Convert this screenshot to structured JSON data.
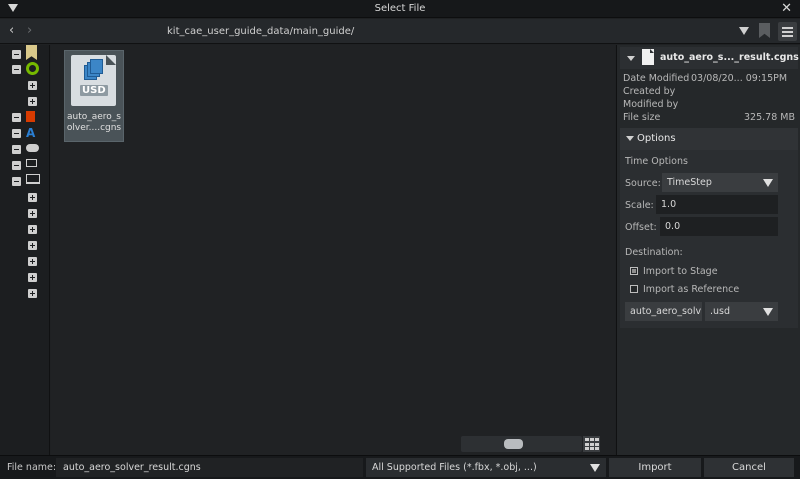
{
  "window": {
    "title": "Select File"
  },
  "nav": {
    "path": "kit_cae_user_guide_data/main_guide/"
  },
  "files": [
    {
      "name": "auto_aero_s olver....cgns",
      "badge": "USD"
    }
  ],
  "detail": {
    "file_name": "auto_aero_s..._result.cgns",
    "date_modified_label": "Date Modified",
    "date_modified_value": "03/08/20... 09:15PM",
    "created_by_label": "Created by",
    "modified_by_label": "Modified by",
    "file_size_label": "File size",
    "file_size_value": "325.78 MB"
  },
  "options": {
    "header": "Options",
    "time_options_label": "Time Options",
    "source_label": "Source:",
    "source_value": "TimeStep",
    "scale_label": "Scale:",
    "scale_value": "1.0",
    "offset_label": "Offset:",
    "offset_value": "0.0",
    "destination_label": "Destination:",
    "import_to_stage_label": "Import to Stage",
    "import_to_stage_checked": true,
    "import_as_reference_label": "Import as Reference",
    "import_as_reference_checked": false,
    "output_name": "auto_aero_solv",
    "output_ext": ".usd"
  },
  "bottom": {
    "file_name_label": "File name:",
    "file_name_value": "auto_aero_solver_result.cgns",
    "filter_value": "All Supported Files (*.fbx, *.obj, ...)",
    "import_label": "Import",
    "cancel_label": "Cancel"
  },
  "colors": {
    "accent_blue": "#3c86c7",
    "tile_bg": "#4a5358"
  }
}
